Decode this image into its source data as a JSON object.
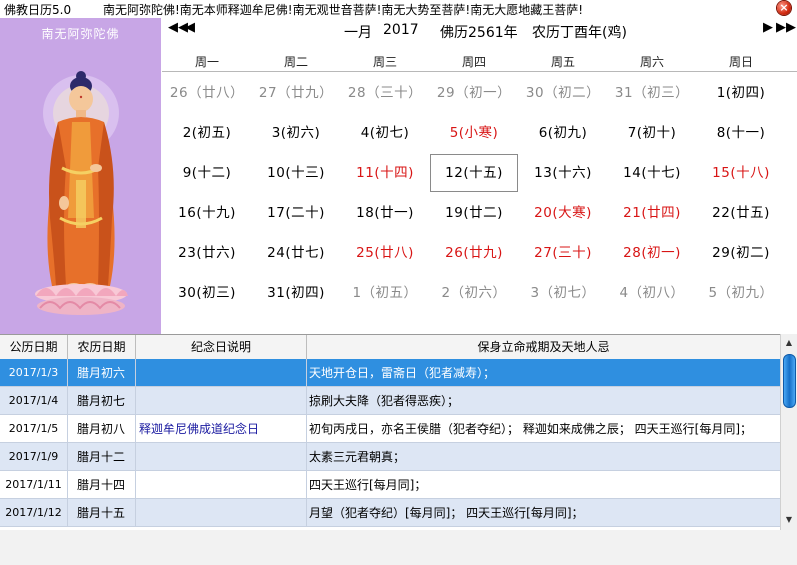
{
  "app": {
    "title": "佛教日历5.0",
    "marquee": "南无阿弥陀佛!南无本师释迦牟尼佛!南无观世音菩萨!南无大势至菩萨!南无大愿地藏王菩萨!",
    "close_icon": "×"
  },
  "buddha": {
    "caption": "南无阿弥陀佛",
    "background_color": "#c8a6e6"
  },
  "calendar": {
    "nav": {
      "prev_year": "◀◀",
      "prev_month": "◀",
      "next_month": "▶",
      "next_year": "▶▶"
    },
    "month": "一月",
    "year": "2017",
    "buddhist_year": "佛历2561年",
    "lunar_year": "农历丁酉年(鸡)",
    "weekdays": [
      "周一",
      "周二",
      "周三",
      "周四",
      "周五",
      "周六",
      "周日"
    ],
    "weeks": [
      [
        {
          "label": "26（廿八）",
          "type": "other"
        },
        {
          "label": "27（廿九）",
          "type": "other"
        },
        {
          "label": "28（三十）",
          "type": "other"
        },
        {
          "label": "29（初一）",
          "type": "other"
        },
        {
          "label": "30（初二）",
          "type": "other"
        },
        {
          "label": "31（初三）",
          "type": "other"
        },
        {
          "label": "1(初四)",
          "type": "normal"
        }
      ],
      [
        {
          "label": "2(初五)",
          "type": "normal"
        },
        {
          "label": "3(初六)",
          "type": "normal"
        },
        {
          "label": "4(初七)",
          "type": "normal"
        },
        {
          "label": "5(小寒)",
          "type": "holiday"
        },
        {
          "label": "6(初九)",
          "type": "normal"
        },
        {
          "label": "7(初十)",
          "type": "normal"
        },
        {
          "label": "8(十一)",
          "type": "normal"
        }
      ],
      [
        {
          "label": "9(十二)",
          "type": "normal"
        },
        {
          "label": "10(十三)",
          "type": "normal"
        },
        {
          "label": "11(十四)",
          "type": "holiday"
        },
        {
          "label": "12(十五)",
          "type": "today"
        },
        {
          "label": "13(十六)",
          "type": "normal"
        },
        {
          "label": "14(十七)",
          "type": "normal"
        },
        {
          "label": "15(十八)",
          "type": "holiday"
        }
      ],
      [
        {
          "label": "16(十九)",
          "type": "normal"
        },
        {
          "label": "17(二十)",
          "type": "normal"
        },
        {
          "label": "18(廿一)",
          "type": "normal"
        },
        {
          "label": "19(廿二)",
          "type": "normal"
        },
        {
          "label": "20(大寒)",
          "type": "holiday"
        },
        {
          "label": "21(廿四)",
          "type": "holiday"
        },
        {
          "label": "22(廿五)",
          "type": "normal"
        }
      ],
      [
        {
          "label": "23(廿六)",
          "type": "normal"
        },
        {
          "label": "24(廿七)",
          "type": "normal"
        },
        {
          "label": "25(廿八)",
          "type": "holiday"
        },
        {
          "label": "26(廿九)",
          "type": "holiday"
        },
        {
          "label": "27(三十)",
          "type": "holiday"
        },
        {
          "label": "28(初一)",
          "type": "holiday"
        },
        {
          "label": "29(初二)",
          "type": "normal"
        }
      ],
      [
        {
          "label": "30(初三)",
          "type": "normal"
        },
        {
          "label": "31(初四)",
          "type": "normal"
        },
        {
          "label": "1（初五）",
          "type": "other"
        },
        {
          "label": "2（初六）",
          "type": "other"
        },
        {
          "label": "3（初七）",
          "type": "other"
        },
        {
          "label": "4（初八）",
          "type": "other"
        },
        {
          "label": "5（初九）",
          "type": "other"
        }
      ]
    ],
    "colors": {
      "holiday": "#d81515",
      "other_month": "#8a8a8a"
    }
  },
  "table": {
    "columns": [
      "公历日期",
      "农历日期",
      "纪念日说明",
      "保身立命戒期及天地人忌"
    ],
    "rows": [
      {
        "date": "2017/1/3",
        "lunar": "腊月初六",
        "memorial": "",
        "notes": "天地开仓日，雷斋日（犯者减寿）；",
        "selected": true
      },
      {
        "date": "2017/1/4",
        "lunar": "腊月初七",
        "memorial": "",
        "notes": "掠刷大夫降（犯者得恶疾）；",
        "selected": false
      },
      {
        "date": "2017/1/5",
        "lunar": "腊月初八",
        "memorial": "释迦牟尼佛成道纪念日",
        "notes": "初旬丙戌日，亦名王侯腊（犯者夺纪）；  释迦如来成佛之辰；  四天王巡行[每月同]；",
        "selected": false
      },
      {
        "date": "2017/1/9",
        "lunar": "腊月十二",
        "memorial": "",
        "notes": "太素三元君朝真；",
        "selected": false
      },
      {
        "date": "2017/1/11",
        "lunar": "腊月十四",
        "memorial": "",
        "notes": "四天王巡行[每月同]；",
        "selected": false
      },
      {
        "date": "2017/1/12",
        "lunar": "腊月十五",
        "memorial": "",
        "notes": "月望（犯者夺纪）[每月同]；   四天王巡行[每月同]；",
        "selected": false
      }
    ],
    "colors": {
      "selected": "#2f8fe0",
      "alt_row": "#dde6f4"
    }
  },
  "scrollbar": {
    "up_icon": "▲",
    "down_icon": "▼"
  }
}
